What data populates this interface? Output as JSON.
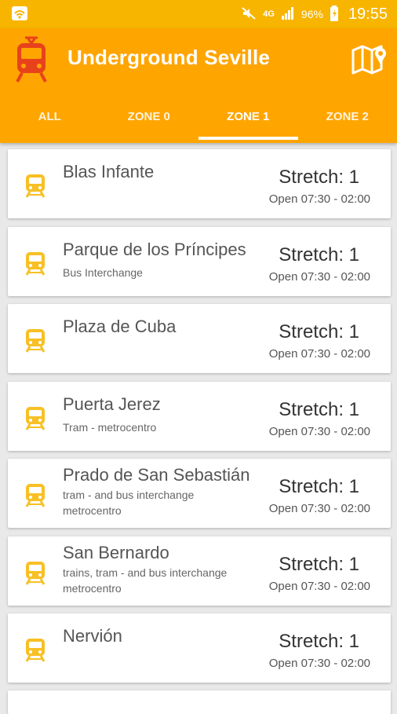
{
  "status_bar": {
    "network": "4G",
    "battery": "96%",
    "time": "19:55"
  },
  "app_bar": {
    "title": "Underground Seville",
    "colors": {
      "primary": "#ffa500",
      "status": "#f7b500",
      "logo": "#e8421c"
    }
  },
  "tabs": [
    {
      "label": "ALL",
      "active": false
    },
    {
      "label": "ZONE 0",
      "active": false
    },
    {
      "label": "ZONE 1",
      "active": true
    },
    {
      "label": "ZONE 2",
      "active": false
    }
  ],
  "stations": [
    {
      "name": "Blas Infante",
      "desc": "",
      "stretch": "Stretch: 1",
      "hours": "Open 07:30 - 02:00"
    },
    {
      "name": "Parque de los Príncipes",
      "desc": "Bus Interchange",
      "stretch": "Stretch: 1",
      "hours": "Open 07:30 - 02:00"
    },
    {
      "name": "Plaza de Cuba",
      "desc": "",
      "stretch": "Stretch: 1",
      "hours": "Open 07:30 - 02:00"
    },
    {
      "name": "Puerta Jerez",
      "desc": "Tram - metrocentro",
      "stretch": "Stretch: 1",
      "hours": "Open 07:30 - 02:00"
    },
    {
      "name": "Prado de San Sebastián",
      "desc": "tram - and bus interchange metrocentro",
      "stretch": "Stretch: 1",
      "hours": "Open 07:30 - 02:00"
    },
    {
      "name": "San Bernardo",
      "desc": "trains, tram - and bus interchange metrocentro",
      "stretch": "Stretch: 1",
      "hours": "Open 07:30 - 02:00"
    },
    {
      "name": "Nervión",
      "desc": "",
      "stretch": "Stretch: 1",
      "hours": "Open 07:30 - 02:00"
    }
  ]
}
